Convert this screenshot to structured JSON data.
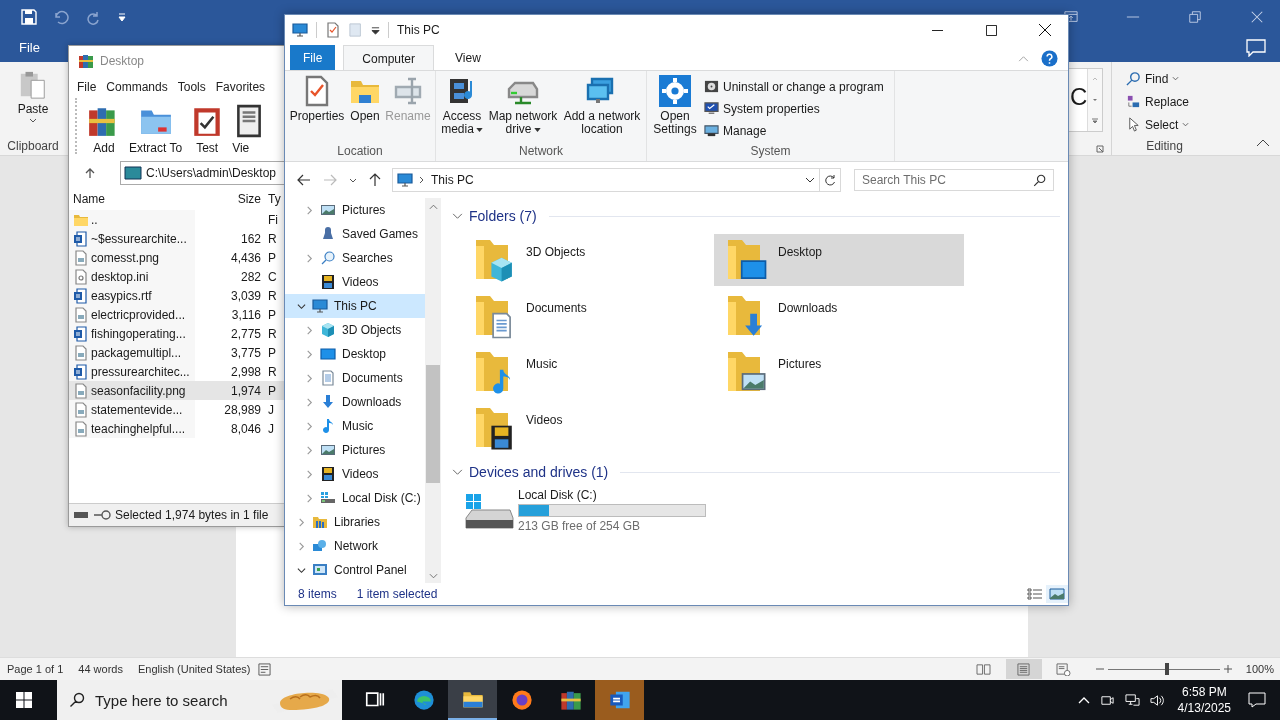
{
  "word": {
    "tabs": [
      {
        "label": "File"
      }
    ],
    "ribbon": {
      "paste": "Paste",
      "clipboard": "Clipboard",
      "style_preview": "C",
      "editing": [
        {
          "label": "Find",
          "kind": "find",
          "dropdown": true
        },
        {
          "label": "Replace",
          "kind": "replace",
          "dropdown": false
        },
        {
          "label": "Select",
          "kind": "select",
          "dropdown": true
        }
      ],
      "editing_group": "Editing"
    },
    "status_bar": {
      "page": "Page 1 of 1",
      "words": "44 words",
      "language": "English (United States)",
      "views": [
        {
          "kind": "read",
          "selected": false
        },
        {
          "kind": "print",
          "selected": true
        },
        {
          "kind": "web",
          "selected": false
        }
      ],
      "zoom_slider": {
        "level": 0.53
      },
      "zoom": "100%"
    }
  },
  "winrar": {
    "title": "Desktop",
    "menu": [
      "File",
      "Commands",
      "Tools",
      "Favorites"
    ],
    "toolbar": [
      {
        "label": "Add",
        "kind": "add"
      },
      {
        "label": "Extract To",
        "kind": "extract"
      },
      {
        "label": "Test",
        "kind": "test"
      },
      {
        "label": "Vie",
        "kind": "view"
      }
    ],
    "path": "C:\\Users\\admin\\Desktop",
    "columns": [
      "Name",
      "Size",
      "Ty"
    ],
    "rows": [
      {
        "name": "..",
        "kind": "folder",
        "type": "Fi",
        "selected": false
      },
      {
        "name": "~$essurearchite...",
        "kind": "word",
        "size": "162",
        "type": "R",
        "selected": false
      },
      {
        "name": "comesst.png",
        "kind": "image",
        "size": "4,436",
        "type": "P",
        "selected": false
      },
      {
        "name": "desktop.ini",
        "kind": "settings",
        "size": "282",
        "type": "C",
        "selected": false
      },
      {
        "name": "easypics.rtf",
        "kind": "word",
        "size": "3,039",
        "type": "R",
        "selected": false
      },
      {
        "name": "electricprovided...",
        "kind": "image",
        "size": "3,116",
        "type": "P",
        "selected": false
      },
      {
        "name": "fishingoperating...",
        "kind": "word",
        "size": "2,775",
        "type": "R",
        "selected": false
      },
      {
        "name": "packagemultipl...",
        "kind": "image",
        "size": "3,775",
        "type": "P",
        "selected": false
      },
      {
        "name": "pressurearchitec...",
        "kind": "word",
        "size": "2,998",
        "type": "R",
        "selected": false
      },
      {
        "name": "seasonfacility.png",
        "kind": "image",
        "size": "1,974",
        "type": "P",
        "selected": true
      },
      {
        "name": "statementevide...",
        "kind": "image",
        "size": "28,989",
        "type": "J",
        "selected": false
      },
      {
        "name": "teachinghelpful....",
        "kind": "image",
        "size": "8,046",
        "type": "J",
        "selected": false
      }
    ],
    "status": "Selected 1,974 bytes in 1 file"
  },
  "explorer": {
    "title": "This PC",
    "tabs": [
      {
        "label": "File",
        "kind": "file",
        "selected": false
      },
      {
        "label": "Computer",
        "kind": "tab",
        "selected": true
      },
      {
        "label": "View",
        "kind": "tab",
        "selected": false
      }
    ],
    "ribbon": [
      {
        "label": "Location",
        "buttons": [
          {
            "label": "Properties",
            "kind": "properties",
            "disabled": false,
            "dropdown": false
          },
          {
            "label": "Open",
            "kind": "open",
            "disabled": false,
            "dropdown": false
          },
          {
            "label": "Rename",
            "kind": "rename",
            "disabled": true,
            "dropdown": false
          }
        ]
      },
      {
        "label": "Network",
        "buttons": [
          {
            "label": "Access media",
            "kind": "media",
            "disabled": false,
            "dropdown": true
          },
          {
            "label": "Map network drive",
            "kind": "mapdrive",
            "disabled": false,
            "dropdown": true
          },
          {
            "label": "Add a network location",
            "kind": "addloc",
            "disabled": false,
            "dropdown": false
          }
        ]
      },
      {
        "label": "System",
        "buttons": [
          {
            "label": "Open Settings",
            "kind": "settings",
            "disabled": false,
            "dropdown": false
          }
        ],
        "small_buttons": [
          {
            "label": "Uninstall or change a program",
            "kind": "uninstall"
          },
          {
            "label": "System properties",
            "kind": "sysprops"
          },
          {
            "label": "Manage",
            "kind": "manage"
          }
        ]
      }
    ],
    "address": "This PC",
    "search": {
      "placeholder": "Search This PC"
    },
    "nav_tree": [
      {
        "children": [
          {
            "label": "Pictures",
            "kind": "pictures",
            "expandable": true,
            "expanded": false,
            "selected": false
          },
          {
            "label": "Saved Games",
            "kind": "games",
            "expandable": false,
            "selected": false
          },
          {
            "label": "Searches",
            "kind": "search",
            "expandable": true,
            "expanded": false,
            "selected": false
          },
          {
            "label": "Videos",
            "kind": "videos",
            "expandable": false,
            "selected": false
          }
        ]
      },
      {
        "label": "This PC",
        "kind": "pc",
        "expandable": true,
        "expanded": true,
        "selected": true,
        "children": [
          {
            "label": "3D Objects",
            "kind": "cube",
            "expandable": true,
            "expanded": false,
            "selected": false
          },
          {
            "label": "Desktop",
            "kind": "desktop",
            "expandable": true,
            "expanded": false,
            "selected": false
          },
          {
            "label": "Documents",
            "kind": "documents",
            "expandable": true,
            "expanded": false,
            "selected": false
          },
          {
            "label": "Downloads",
            "kind": "downloads",
            "expandable": true,
            "expanded": false,
            "selected": false
          },
          {
            "label": "Music",
            "kind": "music",
            "expandable": true,
            "expanded": false,
            "selected": false
          },
          {
            "label": "Pictures",
            "kind": "pictures",
            "expandable": true,
            "expanded": false,
            "selected": false
          },
          {
            "label": "Videos",
            "kind": "videos",
            "expandable": true,
            "expanded": false,
            "selected": false
          },
          {
            "label": "Local Disk (C:)",
            "kind": "disk",
            "expandable": true,
            "expanded": false,
            "selected": false
          }
        ]
      },
      {
        "label": "Libraries",
        "kind": "libraries",
        "expandable": true,
        "expanded": false,
        "selected": false
      },
      {
        "label": "Network",
        "kind": "network",
        "expandable": true,
        "expanded": false,
        "selected": false
      },
      {
        "label": "Control Panel",
        "kind": "control",
        "expandable": true,
        "expanded": true,
        "selected": false
      }
    ],
    "folders": {
      "title": "Folders (7)",
      "expanded": true,
      "items": [
        {
          "label": "3D Objects",
          "kind": "cube",
          "selected": false
        },
        {
          "label": "Desktop",
          "kind": "desktop",
          "selected": true
        },
        {
          "label": "Documents",
          "kind": "documents",
          "selected": false
        },
        {
          "label": "Downloads",
          "kind": "downloads",
          "selected": false
        },
        {
          "label": "Music",
          "kind": "music",
          "selected": false
        },
        {
          "label": "Pictures",
          "kind": "pictures",
          "selected": false
        },
        {
          "label": "Videos",
          "kind": "videos",
          "selected": false
        }
      ]
    },
    "devices": {
      "title": "Devices and drives (1)",
      "expanded": true,
      "drives": [
        {
          "label": "Local Disk (C:)",
          "level": 0.16,
          "free": "213 GB free of 254 GB"
        }
      ]
    },
    "status": {
      "count": "8 items",
      "selection": "1 item selected"
    },
    "view_modes": [
      {
        "kind": "details",
        "selected": false
      },
      {
        "kind": "large_icons",
        "selected": true
      }
    ]
  },
  "taskbar": {
    "search": {
      "placeholder": "Type here to search"
    },
    "apps": [
      {
        "kind": "taskview",
        "selected": false,
        "attention": false
      },
      {
        "kind": "edge",
        "selected": false,
        "attention": false
      },
      {
        "kind": "explorer",
        "selected": true,
        "attention": false
      },
      {
        "kind": "firefox",
        "selected": false,
        "attention": false
      },
      {
        "kind": "winrar",
        "selected": false,
        "attention": false
      },
      {
        "kind": "wordapp",
        "selected": false,
        "attention": true
      }
    ],
    "time": "6:58 PM",
    "date": "4/13/2025"
  }
}
